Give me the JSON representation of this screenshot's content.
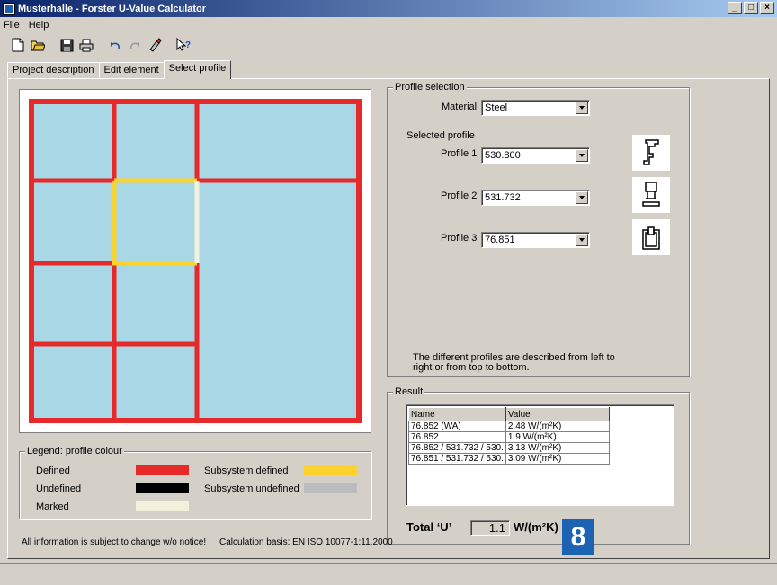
{
  "window": {
    "title": "Musterhalle - Forster U-Value Calculator",
    "buttons": [
      "_",
      "□",
      "×"
    ]
  },
  "menu": [
    "File",
    "Help"
  ],
  "toolbar": [
    "new-icon",
    "open-icon",
    "save-icon",
    "print-icon",
    "undo-icon",
    "redo-icon",
    "paint-icon",
    "help-pointer-icon"
  ],
  "tabs": [
    {
      "label": "Project description",
      "active": false
    },
    {
      "label": "Edit element",
      "active": false
    },
    {
      "label": "Select profile",
      "active": true
    }
  ],
  "profile_selection": {
    "title": "Profile selection",
    "material_label": "Material",
    "material_value": "Steel",
    "selected_profile_label": "Selected profile",
    "profiles": [
      {
        "label": "Profile 1",
        "value": "530.800"
      },
      {
        "label": "Profile 2",
        "value": "531.732"
      },
      {
        "label": "Profile 3",
        "value": "76.851"
      }
    ],
    "note": "The different profiles are described from left to right or from top to bottom."
  },
  "result": {
    "title": "Result",
    "columns": [
      "Name",
      "Value"
    ],
    "rows": [
      [
        "76.852 (WA)",
        "2.48 W/(m²K)"
      ],
      [
        "76.852",
        "1.9 W/(m²K)"
      ],
      [
        "76.852 / 531.732 / 530.",
        "3.13 W/(m²K)"
      ],
      [
        "76.851 / 531.732 / 530.",
        "3.09 W/(m²K)"
      ]
    ],
    "total_label": "Total ‘U’",
    "total_value": "1.1",
    "total_unit": "W/(m²K)"
  },
  "legend": {
    "title": "Legend: profile colour",
    "items": [
      {
        "label": "Defined",
        "color": "#e8292a"
      },
      {
        "label": "Undefined",
        "color": "#000000"
      },
      {
        "label": "Marked",
        "color": "#f2f2dc"
      },
      {
        "label": "Subsystem defined",
        "color": "#fcd22c"
      },
      {
        "label": "Subsystem undefined",
        "color": "#bcbcbc"
      }
    ]
  },
  "footer": {
    "notice": "All information is subject to change w/o notice!",
    "basis": "Calculation basis: EN ISO 10077-1:11.2000"
  },
  "badge": "8",
  "colors": {
    "pane": "#a9d7e5",
    "frame": "#e8292a",
    "selected": "#fcd22c",
    "marked": "#f2f2dc"
  }
}
